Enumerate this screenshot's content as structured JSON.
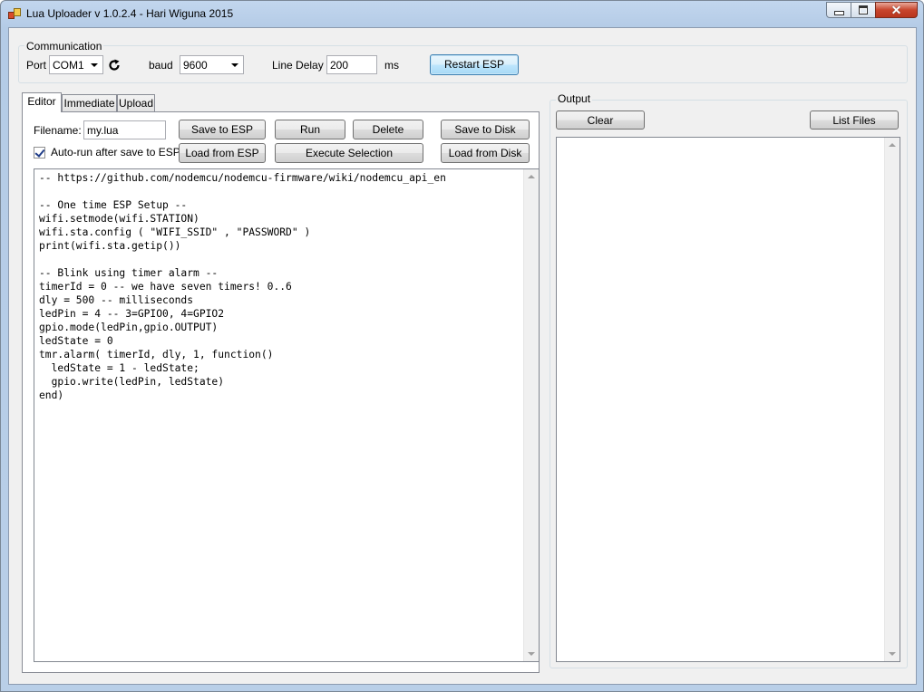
{
  "window": {
    "title": "Lua Uploader v 1.0.2.4 - Hari Wiguna 2015",
    "icon": "app-icon",
    "controls": {
      "minimize": "minimize-icon",
      "maximize": "maximize-icon",
      "close": "✕"
    }
  },
  "communication": {
    "legend": "Communication",
    "port_label": "Port",
    "port_value": "COM1",
    "refresh_icon": "refresh-icon",
    "baud_label": "baud",
    "baud_value": "9600",
    "line_delay_label": "Line Delay",
    "line_delay_value": "200",
    "ms_label": "ms",
    "restart_button": "Restart ESP"
  },
  "tabs": [
    {
      "label": "Editor",
      "active": true
    },
    {
      "label": "Immediate",
      "active": false
    },
    {
      "label": "Upload",
      "active": false
    }
  ],
  "editor": {
    "filename_label": "Filename:",
    "filename_value": "my.lua",
    "save_to_esp": "Save to ESP",
    "run": "Run",
    "delete": "Delete",
    "save_to_disk": "Save to Disk",
    "autorun_label": "Auto-run after save to ESP",
    "autorun_checked": true,
    "load_from_esp": "Load from ESP",
    "execute_selection": "Execute Selection",
    "load_from_disk": "Load from Disk",
    "code": "-- https://github.com/nodemcu/nodemcu-firmware/wiki/nodemcu_api_en\n\n-- One time ESP Setup --\nwifi.setmode(wifi.STATION)\nwifi.sta.config ( \"WIFI_SSID\" , \"PASSWORD\" )\nprint(wifi.sta.getip())\n\n-- Blink using timer alarm --\ntimerId = 0 -- we have seven timers! 0..6\ndly = 500 -- milliseconds\nledPin = 4 -- 3=GPIO0, 4=GPIO2\ngpio.mode(ledPin,gpio.OUTPUT)\nledState = 0\ntmr.alarm( timerId, dly, 1, function()\n  ledState = 1 - ledState;\n  gpio.write(ledPin, ledState)\nend)"
  },
  "output": {
    "legend": "Output",
    "clear_button": "Clear",
    "list_files_button": "List Files",
    "content": ""
  }
}
